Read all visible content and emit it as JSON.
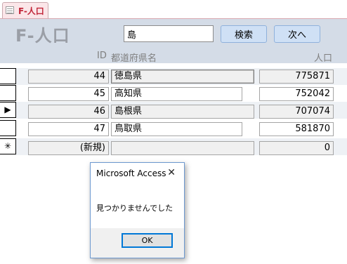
{
  "tab": {
    "label": "F-人口"
  },
  "header": {
    "title": "F-人口",
    "search_value": "島",
    "search_button": "検索",
    "next_button": "次へ"
  },
  "columns": {
    "id": "ID",
    "prefecture": "都道府県名",
    "population": "人口"
  },
  "records": [
    {
      "id": "44",
      "prefecture": "徳島県",
      "population": "775871",
      "selector": ""
    },
    {
      "id": "45",
      "prefecture": "高知県",
      "population": "752042",
      "selector": ""
    },
    {
      "id": "46",
      "prefecture": "島根県",
      "population": "707074",
      "selector": "▶"
    },
    {
      "id": "47",
      "prefecture": "鳥取県",
      "population": "581870",
      "selector": ""
    }
  ],
  "new_record": {
    "id": "(新規)",
    "prefecture": "",
    "population": "0",
    "selector": "✳"
  },
  "dialog": {
    "title": "Microsoft Access",
    "close": "✕",
    "message": "見つかりませんでした",
    "ok": "OK"
  }
}
